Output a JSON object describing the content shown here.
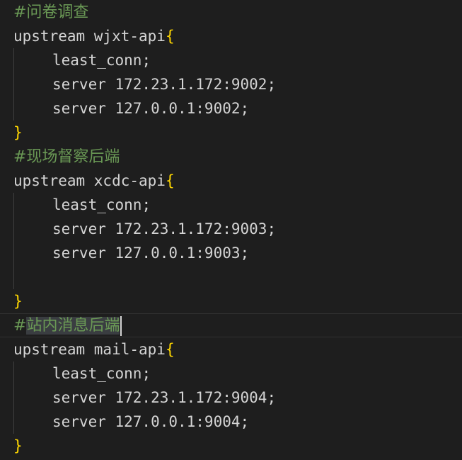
{
  "editor": {
    "lines": [
      {
        "type": "comment",
        "text": "#问卷调查"
      },
      {
        "type": "open",
        "text": "upstream wjxt-api",
        "brace": "{"
      },
      {
        "type": "stmt",
        "text": "least_conn",
        "semi": ";"
      },
      {
        "type": "stmt",
        "text": "server 172.23.1.172:9002",
        "semi": ";"
      },
      {
        "type": "stmt",
        "text": "server 127.0.0.1:9002",
        "semi": ";"
      },
      {
        "type": "close",
        "brace": "}"
      },
      {
        "type": "comment",
        "text": "#现场督察后端"
      },
      {
        "type": "open",
        "text": "upstream xcdc-api",
        "brace": "{"
      },
      {
        "type": "stmt",
        "text": "least_conn",
        "semi": ";"
      },
      {
        "type": "stmt",
        "text": "server 172.23.1.172:9003",
        "semi": ";"
      },
      {
        "type": "stmt",
        "text": "server 127.0.0.1:9003",
        "semi": ";"
      },
      {
        "type": "blank"
      },
      {
        "type": "close",
        "brace": "}"
      },
      {
        "type": "comment-current",
        "hash": "#",
        "text": "站内消息后端"
      },
      {
        "type": "open",
        "text": "upstream mail-api",
        "brace": "{"
      },
      {
        "type": "stmt",
        "text": "least_conn",
        "semi": ";"
      },
      {
        "type": "stmt",
        "text": "server 172.23.1.172:9004",
        "semi": ";"
      },
      {
        "type": "stmt",
        "text": "server 127.0.0.1:9004",
        "semi": ";"
      },
      {
        "type": "close",
        "brace": "}"
      }
    ]
  },
  "colors": {
    "background": "#1e1e1e",
    "comment": "#6a9955",
    "brace": "#ffd700",
    "text": "#d4d4d4"
  }
}
